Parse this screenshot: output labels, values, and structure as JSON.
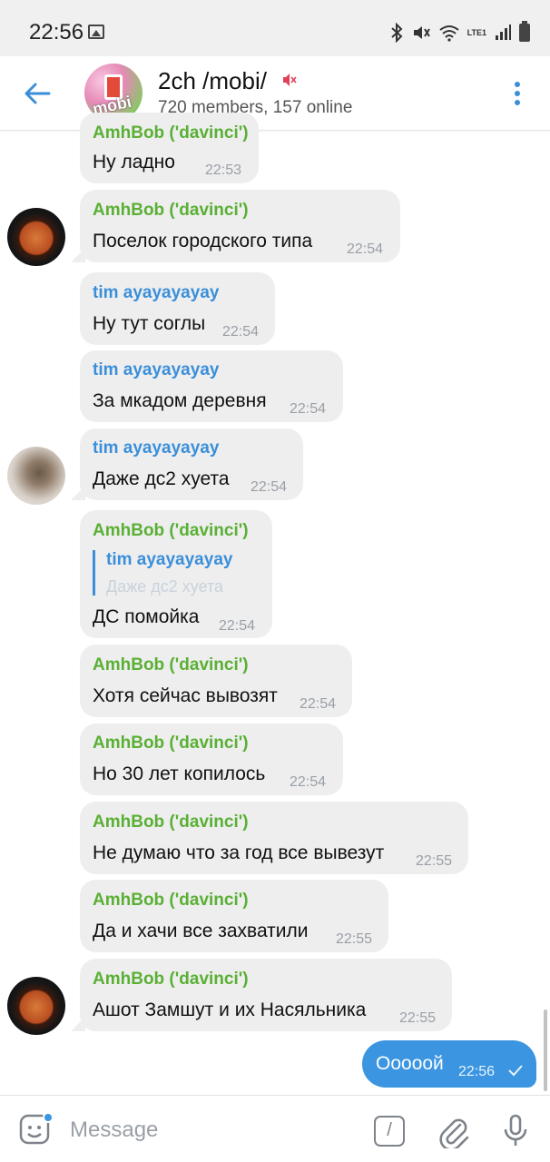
{
  "status_bar": {
    "time": "22:56",
    "network": "LTE1"
  },
  "header": {
    "title": "2ch /mobi/",
    "avatar_label": "mobi",
    "subtitle": "720 members, 157 online"
  },
  "messages": [
    {
      "sender": "AmhBob ('davinci')",
      "text": "Ну ладно",
      "time": "22:53"
    },
    {
      "sender": "AmhBob ('davinci')",
      "text": "Поселок городского типа",
      "time": "22:54"
    },
    {
      "sender": "tim ayayayayay",
      "text": "Ну тут соглы",
      "time": "22:54"
    },
    {
      "sender": "tim ayayayayay",
      "text": "За мкадом деревня",
      "time": "22:54"
    },
    {
      "sender": "tim ayayayayay",
      "text": "Даже дс2 хуета",
      "time": "22:54"
    },
    {
      "sender": "AmhBob ('davinci')",
      "reply_to": {
        "sender": "tim ayayayayay",
        "text": "Даже дс2 хуета"
      },
      "text": "ДС помойка",
      "time": "22:54"
    },
    {
      "sender": "AmhBob ('davinci')",
      "text": "Хотя сейчас вывозят",
      "time": "22:54"
    },
    {
      "sender": "AmhBob ('davinci')",
      "text": "Но 30 лет копилось",
      "time": "22:54"
    },
    {
      "sender": "AmhBob ('davinci')",
      "text": "Не думаю что за год все вывезут",
      "time": "22:55"
    },
    {
      "sender": "AmhBob ('davinci')",
      "text": "Да и хачи все захватили",
      "time": "22:55"
    },
    {
      "sender": "AmhBob ('davinci')",
      "text": "Ашот Замшут и их Насяльника",
      "time": "22:55"
    }
  ],
  "outgoing": {
    "text": "Ооооой",
    "time": "22:56"
  },
  "input": {
    "placeholder": "Message",
    "command_symbol": "/"
  },
  "colors": {
    "accent": "#3b8fd9",
    "sender_green": "#5ab034",
    "bubble_in": "#eeeeef",
    "bubble_out": "#3b95e0"
  }
}
